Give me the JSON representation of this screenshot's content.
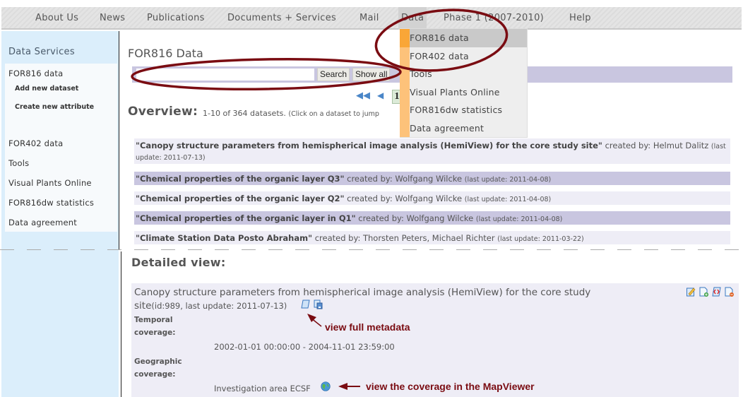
{
  "topnav": {
    "items": [
      {
        "label": "About Us"
      },
      {
        "label": "News"
      },
      {
        "label": "Publications"
      },
      {
        "label": "Documents + Services"
      },
      {
        "label": "Mail"
      },
      {
        "label": "Data",
        "active": true
      },
      {
        "label": "Phase 1 (2007-2010)"
      },
      {
        "label": "Help"
      }
    ]
  },
  "dropdown": {
    "items": [
      {
        "label": "FOR816 data",
        "active": true
      },
      {
        "label": "FOR402 data"
      },
      {
        "label": "Tools"
      },
      {
        "label": "Visual Plants Online"
      },
      {
        "label": "FOR816dw statistics"
      },
      {
        "label": "Data agreement"
      }
    ]
  },
  "sidebar": {
    "title": "Data Services",
    "items": [
      {
        "label": "FOR816 data"
      },
      {
        "label": "Add new dataset"
      },
      {
        "label": "Create new attribute"
      },
      {
        "label": "FOR402 data"
      },
      {
        "label": "Tools"
      },
      {
        "label": "Visual Plants Online"
      },
      {
        "label": "FOR816dw statistics"
      },
      {
        "label": "Data agreement"
      }
    ]
  },
  "main": {
    "title": "FOR816 Data",
    "search": {
      "value": "",
      "placeholder": "",
      "search_label": "Search",
      "show_all_label": "Show all"
    },
    "pager": {
      "first_icon": "first-page-icon",
      "prev_icon": "prev-page-icon",
      "current_page": "1"
    },
    "overview": {
      "label": "Overview:",
      "summary": "1-10 of 364 datasets.",
      "hint": "(Click on a dataset to jump"
    },
    "datasets": [
      {
        "title": "\"Canopy structure parameters from hemispherical image analysis (HemiView) for the core study site\"",
        "created_by": "created by: Helmut Dalitz",
        "updated": "(last update: 2011-07-13)"
      },
      {
        "title": "\"Chemical properties of the organic layer Q3\"",
        "created_by": "created by: Wolfgang Wilcke",
        "updated": "(last update: 2011-04-08)"
      },
      {
        "title": "\"Chemical properties of the organic layer Q2\"",
        "created_by": "created by: Wolfgang Wilcke",
        "updated": "(last update: 2011-04-08)"
      },
      {
        "title": "\"Chemical properties of the organic layer in Q1\"",
        "created_by": "created by: Wolfgang Wilcke",
        "updated": "(last update: 2011-04-08)"
      },
      {
        "title": "\"Climate Station Data Posto Abraham\"",
        "created_by": "created by: Thorsten Peters, Michael Richter",
        "updated": "(last update: 2011-03-22)"
      }
    ],
    "detail": {
      "label": "Detailed view:",
      "title_line1": "Canopy structure parameters from hemispherical image analysis (HemiView) for the core study",
      "title_line2": "site",
      "meta": "(id:989, last update: 2011-07-13)",
      "temporal_label_1": "Temporal",
      "temporal_label_2": "coverage:",
      "temporal_value": "2002-01-01 00:00:00 - 2004-11-01 23:59:00",
      "geo_label_1": "Geographic",
      "geo_label_2": "coverage:",
      "geo_value": "Investigation area ECSF"
    }
  },
  "annotations": {
    "metadata": "view full metadata",
    "mapviewer": "view the coverage in the MapViewer",
    "color": "#7a0c12"
  }
}
